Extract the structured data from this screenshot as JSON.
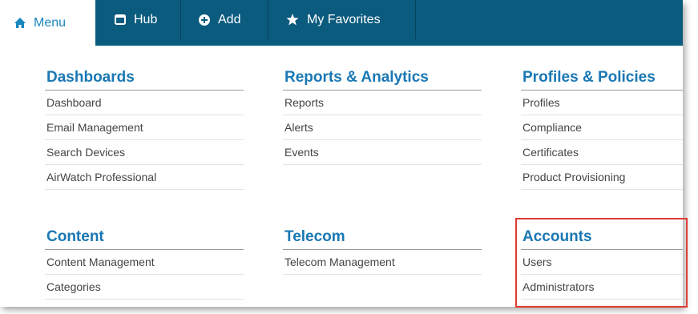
{
  "nav": {
    "tabs": [
      {
        "label": "Menu",
        "icon": "home-icon"
      },
      {
        "label": "Hub",
        "icon": "square-icon"
      },
      {
        "label": "Add",
        "icon": "plus-circle-icon"
      },
      {
        "label": "My Favorites",
        "icon": "star-icon"
      }
    ],
    "active_tab": "Menu"
  },
  "sections": [
    {
      "title": "Dashboards",
      "items": [
        "Dashboard",
        "Email Management",
        "Search Devices",
        "AirWatch Professional"
      ]
    },
    {
      "title": "Reports & Analytics",
      "items": [
        "Reports",
        "Alerts",
        "Events"
      ]
    },
    {
      "title": "Profiles & Policies",
      "items": [
        "Profiles",
        "Compliance",
        "Certificates",
        "Product Provisioning"
      ]
    },
    {
      "title": "Content",
      "items": [
        "Content Management",
        "Categories"
      ]
    },
    {
      "title": "Telecom",
      "items": [
        "Telecom Management"
      ]
    },
    {
      "title": "Accounts",
      "items": [
        "Users",
        "Administrators"
      ]
    }
  ],
  "colors": {
    "navbar": "#0b5b7f",
    "heading": "#1a78b4",
    "highlight": "#e03a32"
  }
}
